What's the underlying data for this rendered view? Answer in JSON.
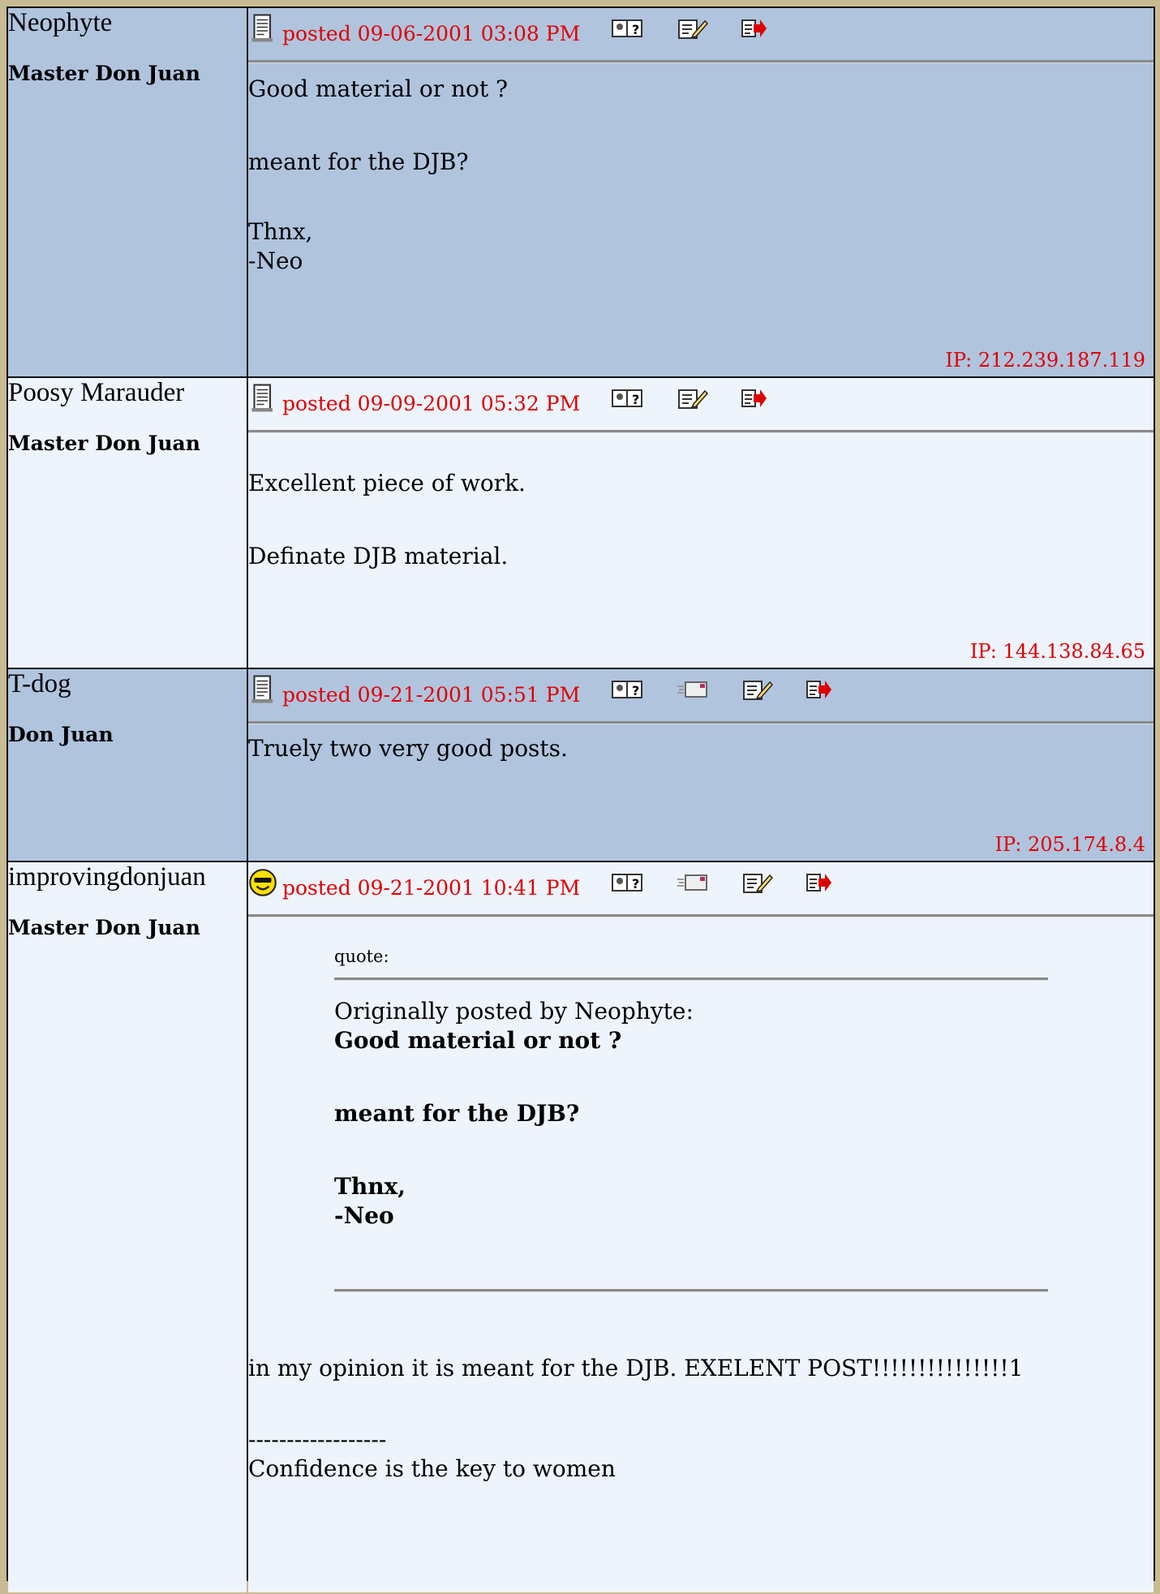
{
  "posts": [
    {
      "author": "Neophyte",
      "rank": "Master Don Juan",
      "icon": "document-icon",
      "posted": "posted 09-06-2001 03:08 PM",
      "has_email": false,
      "body": [
        "Good material or not ?",
        "meant for the DJB?",
        "Thnx,",
        "-Neo"
      ],
      "ip": "IP: 212.239.187.119"
    },
    {
      "author": "Poosy Marauder",
      "rank": "Master Don Juan",
      "icon": "document-icon",
      "posted": "posted 09-09-2001 05:32 PM",
      "has_email": false,
      "body": [
        "Excellent piece of work.",
        "Definate DJB material."
      ],
      "ip": "IP: 144.138.84.65"
    },
    {
      "author": "T-dog",
      "rank": "Don Juan",
      "icon": "document-icon",
      "posted": "posted 09-21-2001 05:51 PM",
      "has_email": true,
      "body": [
        "Truely two very good posts."
      ],
      "ip": "IP: 205.174.8.4"
    },
    {
      "author": "improvingdonjuan",
      "rank": "Master Don Juan",
      "icon": "smiley-cool-icon",
      "posted": "posted 09-21-2001 10:41 PM",
      "has_email": true,
      "quote": {
        "label": "quote:",
        "by": "Originally posted by Neophyte:",
        "lines": [
          "Good material or not ?",
          "meant for the DJB?",
          "Thnx,",
          "-Neo"
        ]
      },
      "body": [
        "in my opinion it is meant for the DJB. EXELENT POST!!!!!!!!!!!!!!!1",
        "------------------",
        "Confidence is the key to women"
      ]
    }
  ],
  "colors": {
    "dark_row": "#b0c4de",
    "light_row": "#eef4fb",
    "accent_red": "#e00000",
    "page_bg": "#c8bb93"
  }
}
